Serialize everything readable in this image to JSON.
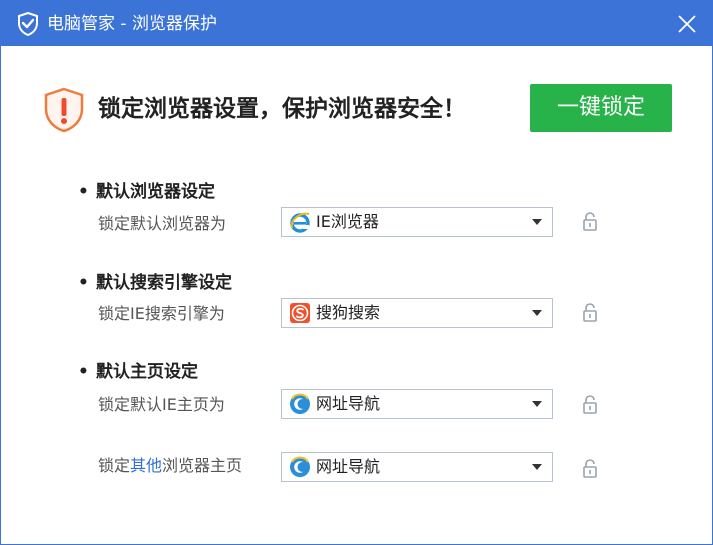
{
  "window": {
    "title": "电脑管家 - 浏览器保护",
    "title_icon": "shield-icon",
    "close_icon": "close-icon",
    "accent_color": "#3b73d6"
  },
  "header": {
    "warning_icon": "warning-shield-icon",
    "headline": "锁定浏览器设置，保护浏览器安全！",
    "lock_all_button": "一键锁定",
    "button_color": "#27b24a"
  },
  "sections": [
    {
      "title": "默认浏览器设定",
      "rows": [
        {
          "label": "锁定默认浏览器为",
          "value": "IE浏览器",
          "icon": "ie-browser-icon",
          "lock_icon": "unlocked-padlock-icon"
        }
      ]
    },
    {
      "title": "默认搜索引擎设定",
      "rows": [
        {
          "label": "锁定IE搜索引擎为",
          "value": "搜狗搜索",
          "icon": "sogou-icon",
          "lock_icon": "unlocked-padlock-icon"
        }
      ]
    },
    {
      "title": "默认主页设定",
      "rows": [
        {
          "label": "锁定默认IE主页为",
          "value": "网址导航",
          "icon": "nav-site-icon",
          "lock_icon": "unlocked-padlock-icon"
        },
        {
          "label_prefix": "锁定",
          "label_highlight": "其他",
          "label_suffix": "浏览器主页",
          "value": "网址导航",
          "icon": "nav-site-icon",
          "lock_icon": "unlocked-padlock-icon"
        }
      ]
    }
  ]
}
